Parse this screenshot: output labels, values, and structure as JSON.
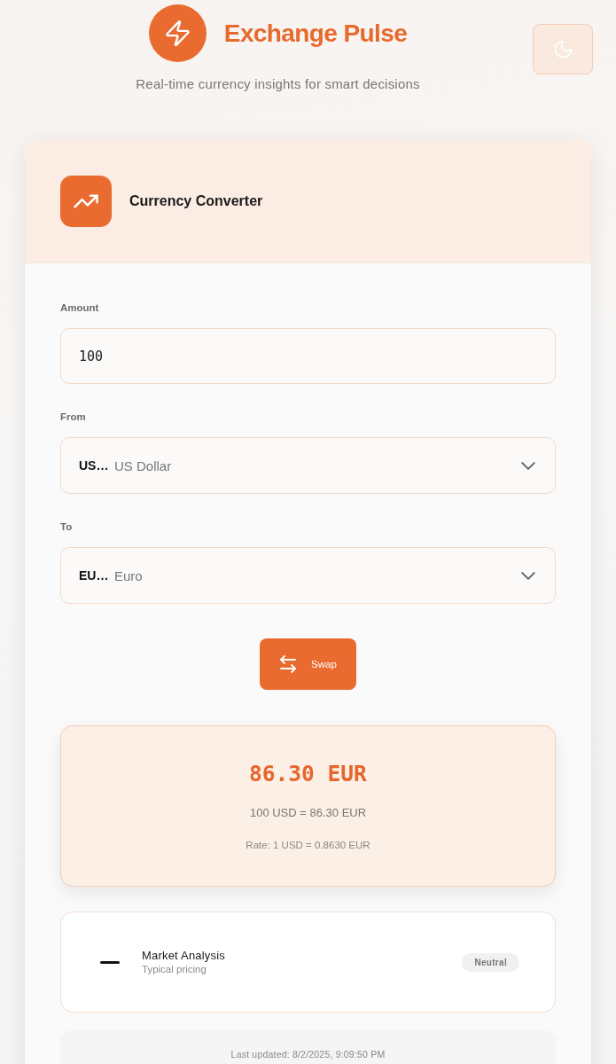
{
  "header": {
    "title": "Exchange Pulse",
    "subtitle": "Real-time currency insights for smart decisions"
  },
  "converter": {
    "title": "Currency Converter",
    "amount": {
      "label": "Amount",
      "value": "100"
    },
    "from": {
      "label": "From",
      "code": "US…",
      "name": "US Dollar"
    },
    "to": {
      "label": "To",
      "code": "EU…",
      "name": "Euro"
    },
    "swap_button": "Swap",
    "result": {
      "value": "86.30 EUR",
      "equation": "100 USD = 86.30 EUR",
      "rate": "Rate: 1 USD = 0.8630 EUR"
    },
    "market": {
      "kind": "neutral",
      "title": "Market Analysis",
      "subtitle": "Typical pricing",
      "badge": "Neutral"
    },
    "last_updated": "Last updated: 8/2/2025, 9:09:50 PM"
  }
}
